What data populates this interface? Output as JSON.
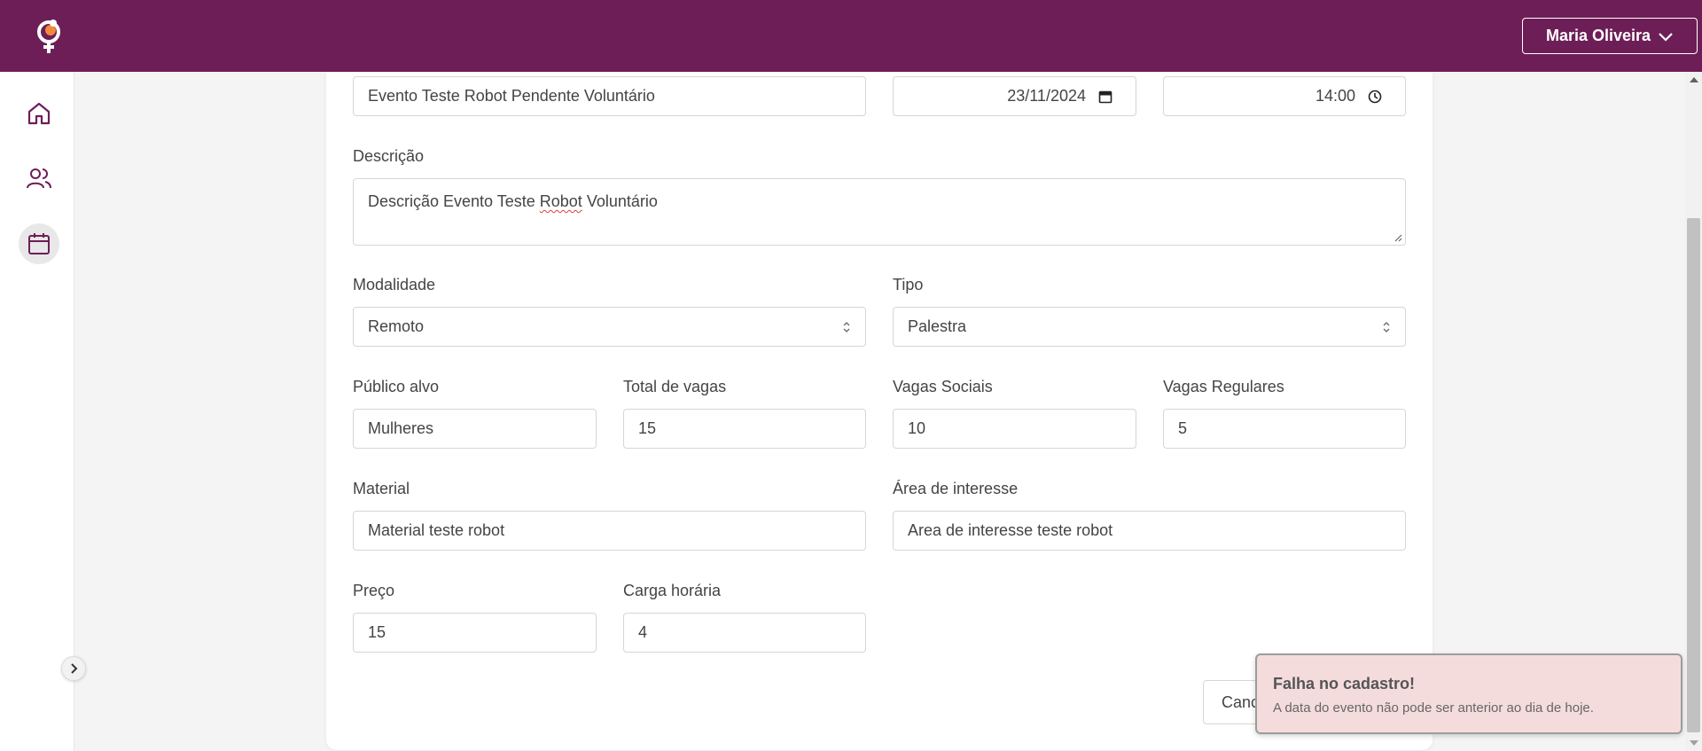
{
  "header": {
    "user_name": "Maria Oliveira",
    "brand_color": "#6e1e57",
    "logo_icon": "venus-logo-icon",
    "menu_icon": "chevron-down-icon"
  },
  "sidebar": {
    "items": [
      {
        "name": "home",
        "icon": "home-icon"
      },
      {
        "name": "users",
        "icon": "users-icon"
      },
      {
        "name": "calendar",
        "icon": "calendar-icon",
        "active": true
      }
    ],
    "expand_icon": "chevron-right-icon"
  },
  "form": {
    "title_value": "Evento Teste Robot Pendente Voluntário",
    "date_value": "23/11/2024",
    "time_value": "14:00",
    "description": {
      "label": "Descrição",
      "value_before": "Descrição Evento Teste ",
      "value_misspelled": "Robot",
      "value_after": " Voluntário"
    },
    "modality": {
      "label": "Modalidade",
      "value": "Remoto"
    },
    "type": {
      "label": "Tipo",
      "value": "Palestra"
    },
    "audience": {
      "label": "Público alvo",
      "value": "Mulheres"
    },
    "total_slots": {
      "label": "Total de vagas",
      "value": "15"
    },
    "social_slots": {
      "label": "Vagas Sociais",
      "value": "10"
    },
    "regular_slots": {
      "label": "Vagas Regulares",
      "value": "5"
    },
    "material": {
      "label": "Material",
      "value": "Material teste robot"
    },
    "interest_area": {
      "label": "Área de interesse",
      "value": "Area de interesse teste robot"
    },
    "price": {
      "label": "Preço",
      "value": "15"
    },
    "workload": {
      "label": "Carga horária",
      "value": "4"
    },
    "cancel_label": "Cancelar"
  },
  "toast": {
    "title": "Falha no cadastro!",
    "message": "A data do evento não pode ser anterior ao dia de hoje.",
    "background": "#f5dcdc"
  }
}
